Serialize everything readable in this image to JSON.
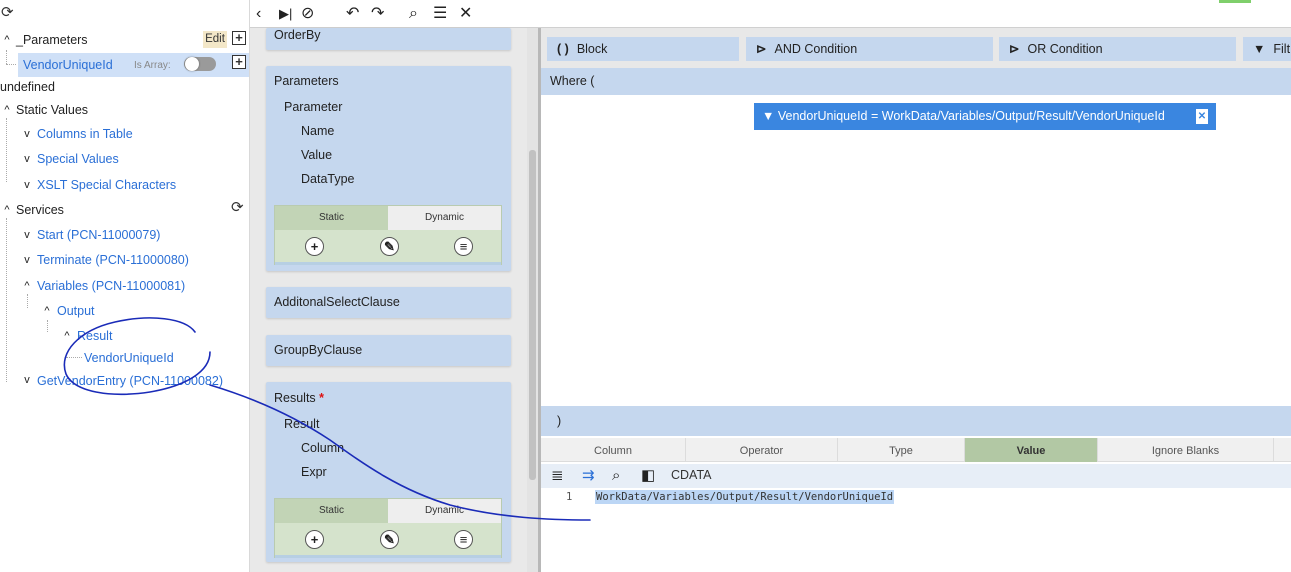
{
  "tree": {
    "parameters_label": "_Parameters",
    "edit_label": "Edit",
    "param_item": "VendorUniqueId",
    "is_array_label": "Is Array:",
    "undefined_label": "undefined",
    "static_values": "Static Values",
    "columns_in_table": "Columns in Table",
    "special_values": "Special Values",
    "xslt_special": "XSLT Special Characters",
    "services": "Services",
    "start": "Start (PCN-11000079)",
    "terminate": "Terminate (PCN-11000080)",
    "variables": "Variables (PCN-11000081)",
    "output": "Output",
    "result": "Result",
    "vendor_unique_id": "VendorUniqueId",
    "get_vendor_entry": "GetVendorEntry (PCN-11000082)"
  },
  "middle": {
    "orderby": "OrderBy",
    "parameters_title": "Parameters",
    "parameter": "Parameter",
    "name": "Name",
    "value": "Value",
    "datatype": "DataType",
    "static_tab": "Static",
    "dynamic_tab": "Dynamic",
    "additional_select": "AdditonalSelectClause",
    "groupby": "GroupByClause",
    "results_title": "Results",
    "required_mark": "*",
    "result": "Result",
    "column": "Column",
    "expr": "Expr"
  },
  "right": {
    "block_label": "Block",
    "and_condition": "AND Condition",
    "or_condition": "OR Condition",
    "filter_label": "Filt",
    "where_label": "Where  (",
    "condition_text": "VendorUniqueId  =  WorkData/Variables/Output/Result/VendorUniqueId",
    "close_paren": ")",
    "tabs": [
      "Column",
      "Operator",
      "Type",
      "Value",
      "Ignore Blanks"
    ],
    "cdata_label": "CDATA",
    "line_number": "1",
    "code_value": "WorkData/Variables/Output/Result/VendorUniqueId"
  },
  "colors": {
    "accent_blue": "#3a86e0",
    "panel_blue": "#c5d7ee",
    "active_tab_green": "#b2c8a4",
    "link_blue": "#2a6fd6",
    "annotation_ink": "#1a2bb8"
  },
  "icons": [
    "refresh-icon",
    "back-icon",
    "step-icon",
    "stop-icon",
    "undo-icon",
    "redo-icon",
    "search-icon",
    "list-icon",
    "close-icon",
    "plus-icon",
    "edit-pencil-icon",
    "edit-notes-icon",
    "filter-icon",
    "delete-icon",
    "align-icon",
    "wrap-icon",
    "book-icon"
  ]
}
